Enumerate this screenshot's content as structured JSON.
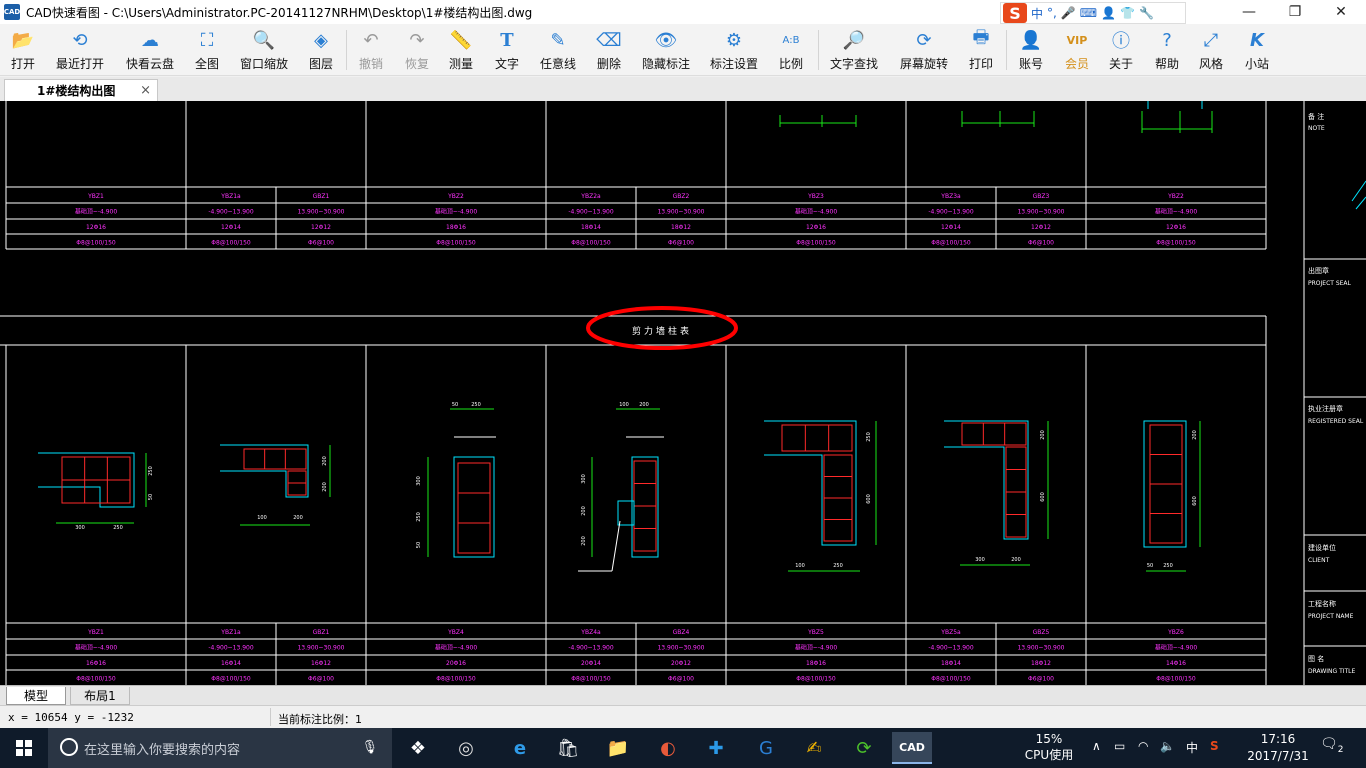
{
  "titlebar": {
    "app_icon": "CAD",
    "title": "CAD快速看图 - C:\\Users\\Administrator.PC-20141127NRHM\\Desktop\\1#楼结构出图.dwg",
    "ime": {
      "logo": "S",
      "mode": "中",
      "punct": "°,",
      "icons": [
        "mic-icon",
        "keyboard-icon",
        "user-icon",
        "shirt-icon",
        "wrench-icon"
      ]
    },
    "controls": {
      "minimize": "—",
      "restore": "❐",
      "close": "✕"
    }
  },
  "toolbar": {
    "items": [
      {
        "label": "打开",
        "icon": "folder-open-icon"
      },
      {
        "label": "最近打开",
        "icon": "history-icon"
      },
      {
        "label": "快看云盘",
        "icon": "cloud-icon"
      },
      {
        "label": "全图",
        "icon": "fit-all-icon"
      },
      {
        "label": "窗口缩放",
        "icon": "zoom-window-icon"
      },
      {
        "label": "图层",
        "icon": "layers-icon"
      },
      {
        "label": "撤销",
        "icon": "undo-icon"
      },
      {
        "label": "恢复",
        "icon": "redo-icon"
      },
      {
        "label": "测量",
        "icon": "ruler-icon"
      },
      {
        "label": "文字",
        "icon": "text-icon"
      },
      {
        "label": "任意线",
        "icon": "pen-icon"
      },
      {
        "label": "删除",
        "icon": "eraser-icon"
      },
      {
        "label": "隐藏标注",
        "icon": "eye-hide-icon"
      },
      {
        "label": "标注设置",
        "icon": "gear-icon"
      },
      {
        "label": "比例",
        "icon": "scale-icon"
      },
      {
        "label": "文字查找",
        "icon": "text-search-icon"
      },
      {
        "label": "屏幕旋转",
        "icon": "rotate-icon"
      },
      {
        "label": "打印",
        "icon": "printer-icon"
      },
      {
        "label": "账号",
        "icon": "account-icon"
      },
      {
        "label": "会员",
        "icon": "vip-icon"
      },
      {
        "label": "关于",
        "icon": "info-icon"
      },
      {
        "label": "帮助",
        "icon": "help-icon"
      },
      {
        "label": "风格",
        "icon": "style-icon"
      },
      {
        "label": "小站",
        "icon": "k-logo-icon"
      }
    ]
  },
  "tabs": {
    "doc_tab": "1#楼结构出图",
    "close": "×"
  },
  "drawing": {
    "heading": "剪力墙柱表",
    "top_rows": {
      "names": [
        "YBZ1",
        "YBZ1a",
        "GBZ1",
        "YBZ2",
        "YBZ2a",
        "GBZ2",
        "YBZ3",
        "YBZ3a",
        "GBZ3",
        "YBZ2"
      ],
      "elevations": [
        "基础顶~-4.900",
        "-4.900~13.900",
        "13.900~30.900",
        "基础顶~-4.900",
        "-4.900~13.900",
        "13.900~30.900",
        "基础顶~-4.900",
        "-4.900~13.900",
        "13.900~30.900",
        "基础顶~-4.900"
      ],
      "rebars": [
        "12Φ16",
        "12Φ14",
        "12Φ12",
        "18Φ16",
        "18Φ14",
        "18Φ12",
        "12Φ16",
        "12Φ14",
        "12Φ12",
        "12Φ16"
      ],
      "stirrups": [
        "Φ8@100/150",
        "Φ8@100/150",
        "Φ6@100",
        "Φ8@100/150",
        "Φ8@100/150",
        "Φ6@100",
        "Φ8@100/150",
        "Φ8@100/150",
        "Φ6@100",
        "Φ8@100/150"
      ]
    },
    "bottom_rows": {
      "names": [
        "YBZ1",
        "YBZ1a",
        "GBZ1",
        "YBZ4",
        "YBZ4a",
        "GBZ4",
        "YBZ5",
        "YBZ5a",
        "GBZ5",
        "YBZ6"
      ],
      "elevations": [
        "基础顶~-4.900",
        "-4.900~13.900",
        "13.900~30.900",
        "基础顶~-4.900",
        "-4.900~13.900",
        "13.900~30.900",
        "基础顶~-4.900",
        "-4.900~13.900",
        "13.900~30.900",
        "基础顶~-4.900"
      ],
      "rebars": [
        "16Φ16",
        "16Φ14",
        "16Φ12",
        "20Φ16",
        "20Φ14",
        "20Φ12",
        "18Φ16",
        "18Φ14",
        "18Φ12",
        "14Φ16"
      ],
      "stirrups": [
        "Φ8@100/150",
        "Φ8@100/150",
        "Φ6@100",
        "Φ8@100/150",
        "Φ8@100/150",
        "Φ6@100",
        "Φ8@100/150",
        "Φ8@100/150",
        "Φ6@100",
        "Φ8@100/150"
      ]
    },
    "dims": {
      "c1": [
        "300",
        "250",
        "250",
        "50"
      ],
      "c2": [
        "100",
        "200",
        "200",
        "200"
      ],
      "c3": [
        "50",
        "250",
        "300",
        "250",
        "50"
      ],
      "c4": [
        "100",
        "200",
        "300",
        "200",
        "200"
      ],
      "c5": [
        "100",
        "250",
        "250",
        "600"
      ],
      "c6": [
        "300",
        "200",
        "200",
        "600"
      ],
      "c7": [
        "50",
        "250",
        "200",
        "600"
      ]
    },
    "titleblock": {
      "note_cn": "备 注",
      "note_en": "NOTE",
      "seal_cn": "出图章",
      "seal_en": "PROJECT SEAL",
      "reg_cn": "执业注册章",
      "reg_en": "REGISTERED SEAL",
      "client_cn": "建设单位",
      "client_en": "CLIENT",
      "project_cn": "工程名称",
      "project_en": "PROJECT NAME",
      "title_cn": "图 名",
      "title_en": "DRAWING TITLE"
    },
    "colors": {
      "frame": "#ffffff",
      "text": "#ff33ff",
      "concrete": "#00e5ff",
      "rebar": "#ff2a2a",
      "dim": "#19e619",
      "highlight": "#ff0000"
    }
  },
  "layout_tabs": {
    "model": "模型",
    "layout1": "布局1"
  },
  "status": {
    "coords": "x = 10654  y = -1232",
    "scale": "当前标注比例：1"
  },
  "taskbar": {
    "search_placeholder": "在这里输入你要搜索的内容",
    "cpu_percent": "15%",
    "cpu_label": "CPU使用",
    "lang": "中",
    "time": "17:16",
    "date": "2017/7/31",
    "notification_count": "2"
  }
}
